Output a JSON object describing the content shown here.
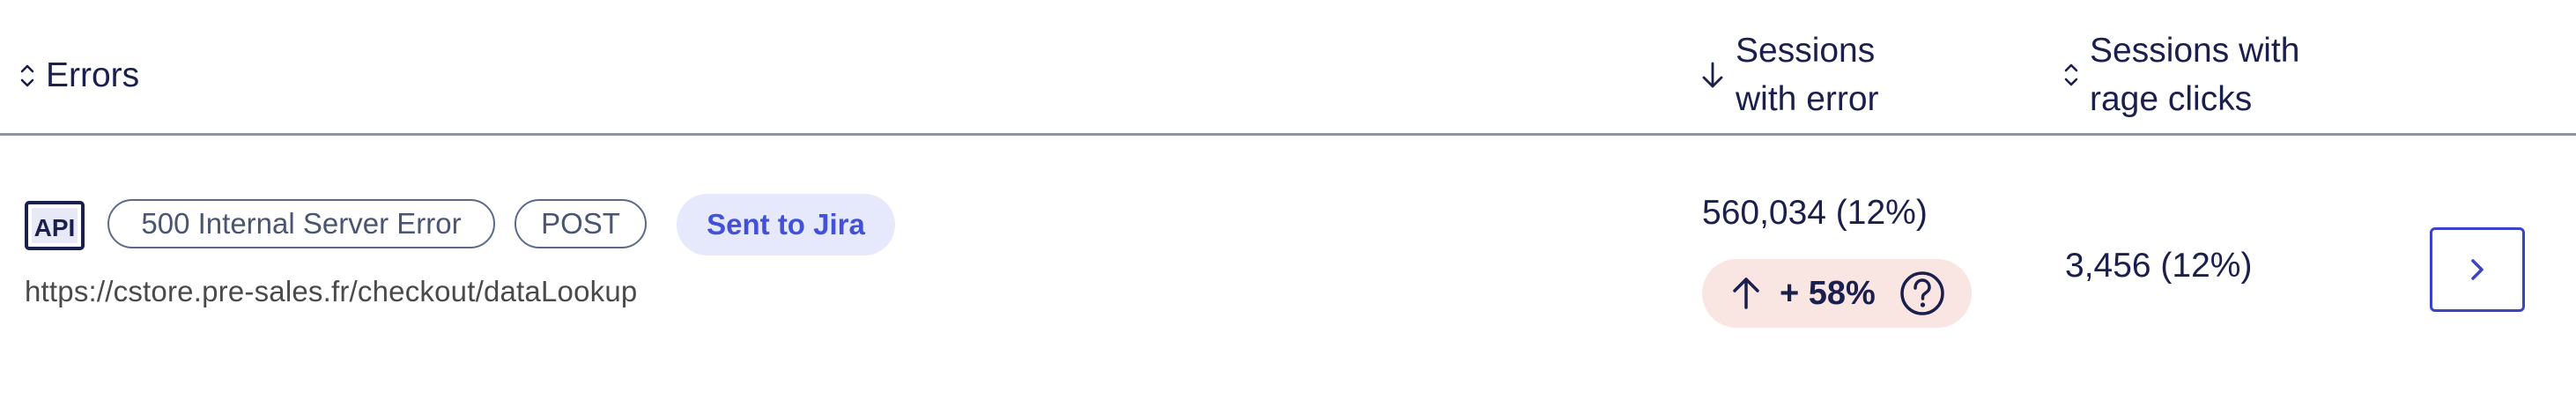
{
  "header": {
    "errors_label": "Errors",
    "sessions_error_line1": "Sessions",
    "sessions_error_line2": "with error",
    "rage_line1": "Sessions with",
    "rage_line2": "rage clicks"
  },
  "row": {
    "type_icon": "API",
    "status_pill": "500 Internal Server Error",
    "method_pill": "POST",
    "jira_badge": "Sent to Jira",
    "url": "https://cstore.pre-sales.fr/checkout/dataLookup",
    "sessions_with_error": "560,034 (12%)",
    "trend": "+ 58%",
    "sessions_rage_clicks": "3,456 (12%)"
  },
  "icons": {
    "errors_sort": "sort-icon",
    "sessions_error_sort": "arrow-down-icon",
    "rage_sort": "sort-icon",
    "trend_arrow": "arrow-up-icon",
    "help": "question-circle-icon",
    "open": "chevron-right-icon"
  },
  "colors": {
    "text": "#1a1f4d",
    "jira_bg": "#e6e8fb",
    "jira_text": "#4351d8",
    "trend_bg": "#f9e6e3",
    "button_border": "#3b43c9"
  }
}
